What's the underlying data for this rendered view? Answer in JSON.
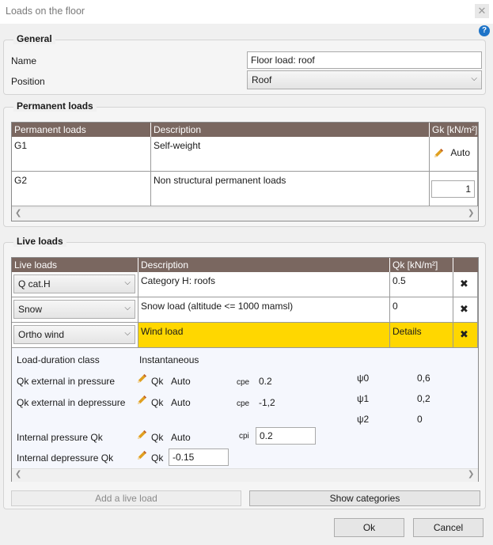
{
  "window": {
    "title": "Loads on the floor",
    "close_glyph": "✕",
    "help_glyph": "?"
  },
  "general": {
    "title": "General",
    "name_label": "Name",
    "name_value": "Floor load: roof",
    "position_label": "Position",
    "position_value": "Roof"
  },
  "permanent": {
    "title": "Permanent loads",
    "columns": [
      "Permanent loads",
      "Description",
      "Gk [kN/m²]"
    ],
    "rows": [
      {
        "id": "G1",
        "description": "Self-weight",
        "value": "Auto"
      },
      {
        "id": "G2",
        "description": "Non structural permanent loads",
        "value": "1"
      }
    ]
  },
  "live": {
    "title": "Live loads",
    "columns": [
      "Live loads",
      "Description",
      "Qk [kN/m²]"
    ],
    "rows": [
      {
        "type": "Q cat.H",
        "description": "Category H: roofs",
        "value": "0.5"
      },
      {
        "type": "Snow",
        "description": "Snow load (altitude <= 1000 mamsl)",
        "value": "0"
      },
      {
        "type": "Ortho wind",
        "description": "Wind load",
        "value": "Details"
      }
    ],
    "details": {
      "ldc_label": "Load-duration class",
      "ldc_value": "Instantaneous",
      "qk_ext_pressure_label": "Qk external in pressure",
      "qk_ext_depressure_label": "Qk external in depressure",
      "internal_pressure_label": "Internal pressure Qk",
      "internal_depressure_label": "Internal depressure Qk",
      "qk_word": "Qk",
      "auto_word": "Auto",
      "cpe_label": "cpe",
      "cpi_label": "cpi",
      "cpe_pressure": "0.2",
      "cpe_depressure": "-1,2",
      "cpi_value": "0.2",
      "internal_depressure_value": "-0.15",
      "psi0_label": "ψ0",
      "psi0_value": "0,6",
      "psi1_label": "ψ1",
      "psi1_value": "0,2",
      "psi2_label": "ψ2",
      "psi2_value": "0"
    },
    "add_button": "Add a live load",
    "show_categories_button": "Show categories"
  },
  "footer": {
    "ok": "Ok",
    "cancel": "Cancel"
  }
}
